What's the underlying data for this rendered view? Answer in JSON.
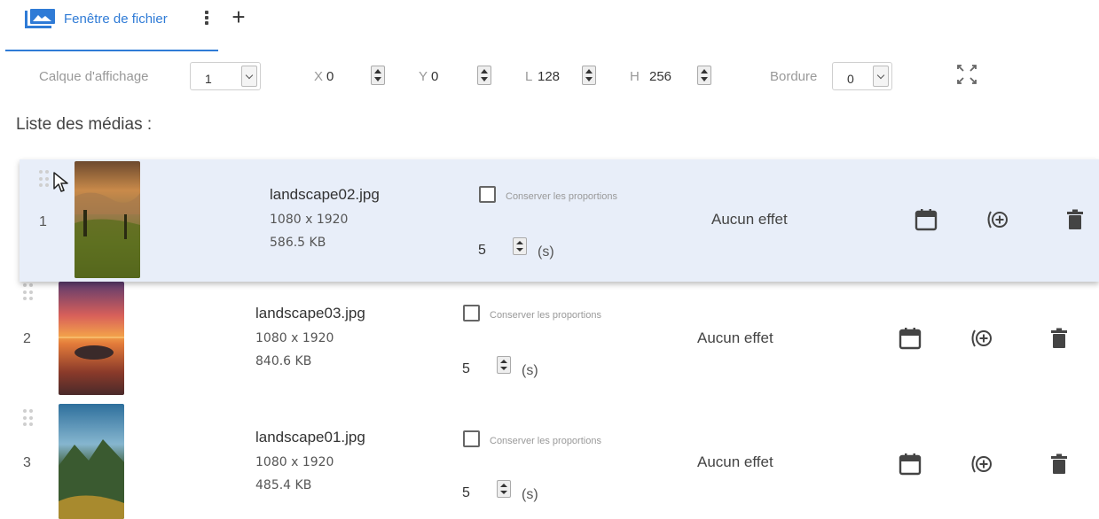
{
  "tab": {
    "icon": "image-gallery-icon",
    "label": "Fenêtre de fichier",
    "accent_color": "#2f7bd6"
  },
  "toolbar": {
    "layer_label": "Calque d'affichage",
    "layer_value": "1",
    "x_label": "X",
    "x_value": "0",
    "y_label": "Y",
    "y_value": "0",
    "w_label": "L",
    "w_value": "128",
    "h_label": "H",
    "h_value": "256",
    "border_label": "Bordure",
    "border_value": "0"
  },
  "media_list": {
    "title": "Liste des médias :",
    "keep_ratio_label": "Conserver les proportions",
    "seconds_unit": "(s)",
    "items": [
      {
        "index": "1",
        "filename": "landscape02.jpg",
        "dimensions": "1080 x 1920",
        "size": "586.5 KB",
        "duration": "5",
        "effect": "Aucun effet",
        "selected": true
      },
      {
        "index": "2",
        "filename": "landscape03.jpg",
        "dimensions": "1080 x 1920",
        "size": "840.6 KB",
        "duration": "5",
        "effect": "Aucun effet",
        "selected": false
      },
      {
        "index": "3",
        "filename": "landscape01.jpg",
        "dimensions": "1080 x 1920",
        "size": "485.4 KB",
        "duration": "5",
        "effect": "Aucun effet",
        "selected": false
      }
    ]
  },
  "colors": {
    "selected_row_bg": "#e8eef9",
    "icon_color": "#444444"
  }
}
